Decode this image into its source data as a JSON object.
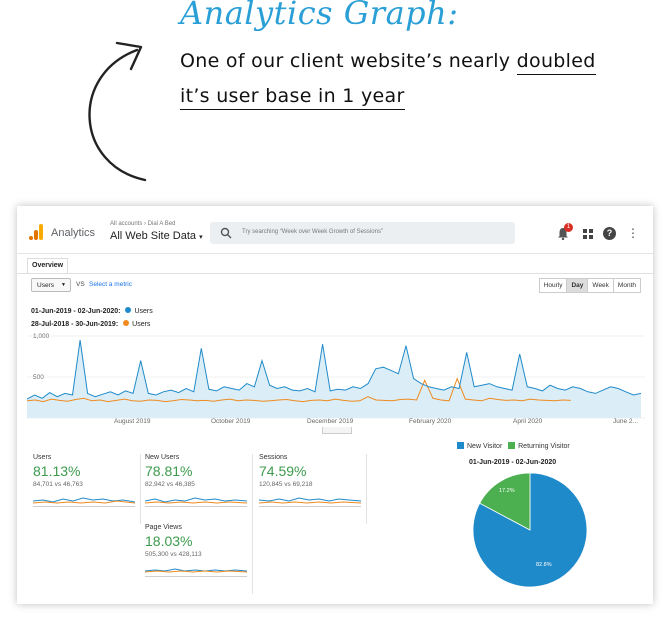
{
  "header": {
    "title": "Analytics Graph:",
    "line1_prefix": "One of our client website’s nearly ",
    "line1_underlined": "doubled",
    "line2_underlined": "it’s user base in 1 year"
  },
  "topbar": {
    "app_name": "Analytics",
    "account_path": "All accounts › Dial A Bed",
    "account_view": "All Web Site Data",
    "search_placeholder": "Try searching “Week over Week Growth of Sessions”",
    "notification_count": "1",
    "help_glyph": "?",
    "more_glyph": "⋮"
  },
  "tabs": {
    "overview": "Overview"
  },
  "controls": {
    "metric": "Users",
    "vs": "VS",
    "select_metric": "Select a metric",
    "granularity": [
      "Hourly",
      "Day",
      "Week",
      "Month"
    ],
    "granularity_active": "Day"
  },
  "ranges": {
    "current": "01-Jun-2019 - 02-Jun-2020:",
    "previous": "28-Jul-2018 - 30-Jun-2019:",
    "metric_label": "Users"
  },
  "colors": {
    "current": "#1f8ac9",
    "previous": "#ef8a1f",
    "accent_green": "#3c9b4d",
    "new_visitor": "#1f8ac9",
    "returning_visitor": "#4caf50"
  },
  "chart_data": [
    {
      "type": "line",
      "ylabels": [
        "1,000",
        "500"
      ],
      "xlabels": [
        "August 2019",
        "October 2019",
        "December 2019",
        "February 2020",
        "April 2020",
        "June 2..."
      ],
      "ylim": [
        0,
        1000
      ],
      "series": [
        {
          "name": "Users",
          "range": "01-Jun-2019 - 02-Jun-2020",
          "values": [
            230,
            280,
            240,
            310,
            260,
            300,
            280,
            950,
            300,
            260,
            290,
            320,
            280,
            330,
            300,
            700,
            300,
            280,
            320,
            340,
            310,
            360,
            320,
            850,
            350,
            330,
            380,
            360,
            340,
            420,
            380,
            700,
            400,
            360,
            380,
            340,
            330,
            360,
            320,
            900,
            330,
            350,
            340,
            380,
            360,
            420,
            600,
            620,
            580,
            540,
            880,
            480,
            420,
            380,
            360,
            340,
            380,
            360,
            800,
            380,
            400,
            420,
            380,
            360,
            340,
            780,
            380,
            360,
            330,
            400,
            360,
            340,
            380,
            360,
            320,
            300,
            340,
            380,
            360,
            320,
            280,
            300
          ]
        },
        {
          "name": "Users",
          "range": "28-Jul-2018 - 30-Jun-2019",
          "values": [
            210,
            220,
            200,
            230,
            215,
            205,
            225,
            240,
            210,
            220,
            200,
            215,
            230,
            210,
            205,
            220,
            215,
            200,
            210,
            225,
            220,
            210,
            215,
            205,
            220,
            230,
            210,
            220,
            215,
            205,
            210,
            220,
            225,
            210,
            200,
            215,
            220,
            210,
            230,
            215,
            205,
            210,
            260,
            220,
            215,
            210,
            225,
            230,
            220,
            460,
            240,
            220,
            210,
            480,
            230,
            220,
            210,
            240,
            225,
            215,
            220,
            210,
            230,
            220,
            215,
            210,
            220,
            215
          ]
        }
      ]
    },
    {
      "type": "pie",
      "title": "01-Jun-2019 - 02-Jun-2020",
      "legend": [
        "New Visitor",
        "Returning Visitor"
      ],
      "slices": [
        {
          "name": "New Visitor",
          "value": 82.8
        },
        {
          "name": "Returning Visitor",
          "value": 17.2
        }
      ],
      "labels": [
        "82.8%",
        "17.2%"
      ]
    }
  ],
  "scorecards": [
    {
      "label": "Users",
      "pct": "81.13%",
      "cmp": "84,701 vs 46,763"
    },
    {
      "label": "New Users",
      "pct": "78.81%",
      "cmp": "82,942 vs 46,385"
    },
    {
      "label": "Sessions",
      "pct": "74.59%",
      "cmp": "120,845 vs 69,218"
    },
    {
      "label": "Page Views",
      "pct": "18.03%",
      "cmp": "505,300 vs 428,113"
    }
  ]
}
